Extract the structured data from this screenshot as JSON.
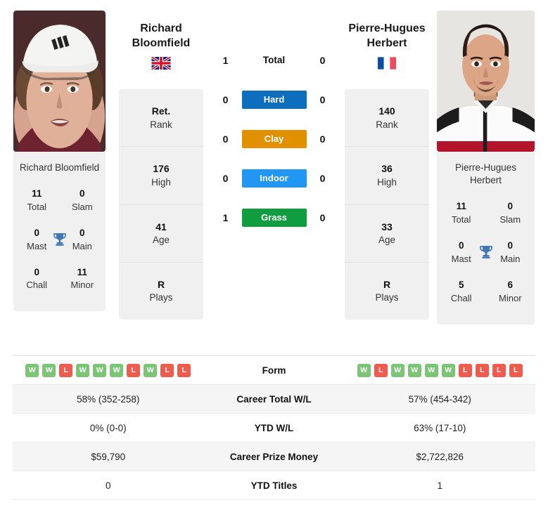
{
  "players": {
    "left": {
      "first_name": "Richard",
      "last_name": "Bloomfield",
      "full_name": "Richard Bloomfield",
      "country_flag": "gb-flag-icon",
      "rank": "Ret.",
      "rank_label": "Rank",
      "high": "176",
      "high_label": "High",
      "age": "41",
      "age_label": "Age",
      "plays": "R",
      "plays_label": "Plays",
      "titles": {
        "total": "11",
        "total_label": "Total",
        "slam": "0",
        "slam_label": "Slam",
        "mast": "0",
        "mast_label": "Mast",
        "main": "0",
        "main_label": "Main",
        "chall": "0",
        "chall_label": "Chall",
        "minor": "11",
        "minor_label": "Minor"
      },
      "form": [
        "W",
        "W",
        "L",
        "W",
        "W",
        "W",
        "L",
        "W",
        "L",
        "L"
      ],
      "career_total_wl": "58% (352-258)",
      "ytd_wl": "0% (0-0)",
      "career_prize_money": "$59,790",
      "ytd_titles": "0"
    },
    "right": {
      "first_name": "Pierre-Hugues",
      "last_name": "Herbert",
      "full_name": "Pierre-Hugues Herbert",
      "country_flag": "fr-flag-icon",
      "rank": "140",
      "rank_label": "Rank",
      "high": "36",
      "high_label": "High",
      "age": "33",
      "age_label": "Age",
      "plays": "R",
      "plays_label": "Plays",
      "titles": {
        "total": "11",
        "total_label": "Total",
        "slam": "0",
        "slam_label": "Slam",
        "mast": "0",
        "mast_label": "Mast",
        "main": "0",
        "main_label": "Main",
        "chall": "5",
        "chall_label": "Chall",
        "minor": "6",
        "minor_label": "Minor"
      },
      "form": [
        "W",
        "L",
        "W",
        "W",
        "W",
        "W",
        "L",
        "L",
        "L",
        "L"
      ],
      "career_total_wl": "57% (454-342)",
      "ytd_wl": "63% (17-10)",
      "career_prize_money": "$2,722,826",
      "ytd_titles": "1"
    }
  },
  "head_to_head": [
    {
      "label": "Total",
      "left": "1",
      "right": "0",
      "color": "",
      "plain": true
    },
    {
      "label": "Hard",
      "left": "0",
      "right": "0",
      "color": "#0d6ebd",
      "plain": false
    },
    {
      "label": "Clay",
      "left": "0",
      "right": "0",
      "color": "#e09000",
      "plain": false
    },
    {
      "label": "Indoor",
      "left": "0",
      "right": "0",
      "color": "#2196f3",
      "plain": false
    },
    {
      "label": "Grass",
      "left": "1",
      "right": "0",
      "color": "#0f9d3f",
      "plain": false
    }
  ],
  "stats_rows": [
    {
      "label": "Form",
      "left": "",
      "right": ""
    },
    {
      "label": "Career Total W/L",
      "left": "58% (352-258)",
      "right": "57% (454-342)"
    },
    {
      "label": "YTD W/L",
      "left": "0% (0-0)",
      "right": "63% (17-10)"
    },
    {
      "label": "Career Prize Money",
      "left": "$59,790",
      "right": "$2,722,826"
    },
    {
      "label": "YTD Titles",
      "left": "0",
      "right": "1"
    }
  ],
  "colors": {
    "win": "#7cc576",
    "loss": "#ef5b4c",
    "trophy": "#3f77b8",
    "card_bg": "#f0f0f0",
    "row_shade": "#f5f5f5"
  },
  "icons": {
    "trophy": "trophy-icon"
  }
}
